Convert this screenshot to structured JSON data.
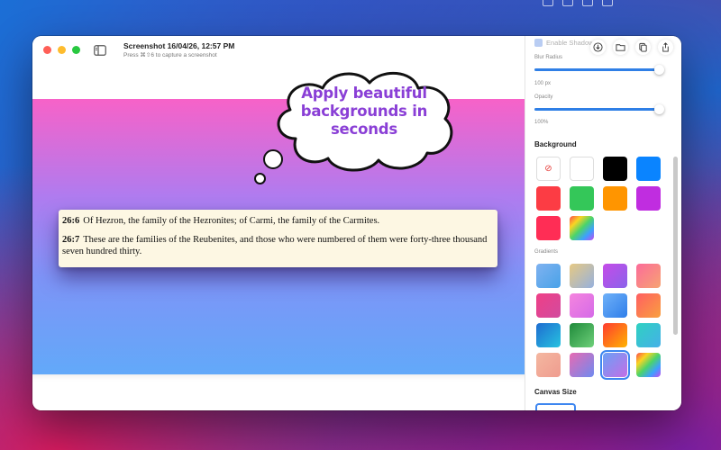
{
  "window": {
    "title": "Screenshot 16/04/26, 12:57 PM",
    "subtitle": "Press ⌘⇧6 to capture a screenshot",
    "traffic_lights": [
      "#ff5f57",
      "#febc2e",
      "#28c840"
    ]
  },
  "bubble": {
    "text": "Apply beautiful backgrounds in seconds"
  },
  "document": {
    "verses": [
      {
        "num": "26:6",
        "text": "Of Hezron, the family of the Hezronites; of Carmi, the family of the Carmites."
      },
      {
        "num": "26:7",
        "text": "These are the families of the Reubenites, and those who were numbered of them were forty-three thousand seven hundred thirty."
      }
    ]
  },
  "panel": {
    "enable_shadow": "Enable Shadow",
    "blur_radius_label": "Blur Radius",
    "blur_radius_value": "100 px",
    "opacity_label": "Opacity",
    "opacity_value": "100%",
    "background_title": "Background",
    "gradients_label": "Gradients",
    "canvas_size_title": "Canvas Size",
    "solid_colors": [
      "none",
      "#ffffff",
      "#000000",
      "#0a84ff",
      "#fc3c44",
      "#34c759",
      "#ff9500",
      "#c02de0",
      "#ff2d55",
      "rainbow"
    ],
    "gradients": [
      "linear-gradient(135deg,#7fb2f0,#49a2e8)",
      "linear-gradient(135deg,#e6c983,#96b1de)",
      "linear-gradient(135deg,#c54ce8,#8a62ea)",
      "linear-gradient(135deg,#fc6b9a,#f6a372)",
      "linear-gradient(135deg,#ef3f86,#d24b9f)",
      "linear-gradient(135deg,#f585de,#d56ae8)",
      "linear-gradient(135deg,#6fb1f8,#2f7eea)",
      "linear-gradient(135deg,#ff5e62,#f9a03f)",
      "linear-gradient(135deg,#1e6cd0,#27c3e0)",
      "linear-gradient(135deg,#1f8a3a,#6ed07a)",
      "linear-gradient(135deg,#ff3b30,#ffb300)",
      "linear-gradient(135deg,#2fd1c1,#45b0e8)",
      "linear-gradient(135deg,#f4b7a0,#ef9c8f)",
      "linear-gradient(135deg,#e76ab2,#6f8af0)",
      "linear-gradient(135deg,#6aa0f5,#c46ee6)",
      "linear-gradient(135deg,#fc4a4a,#f9d423,#4bd46a,#3da0ff,#c54cf0)"
    ],
    "selected_gradient_index": 14
  }
}
